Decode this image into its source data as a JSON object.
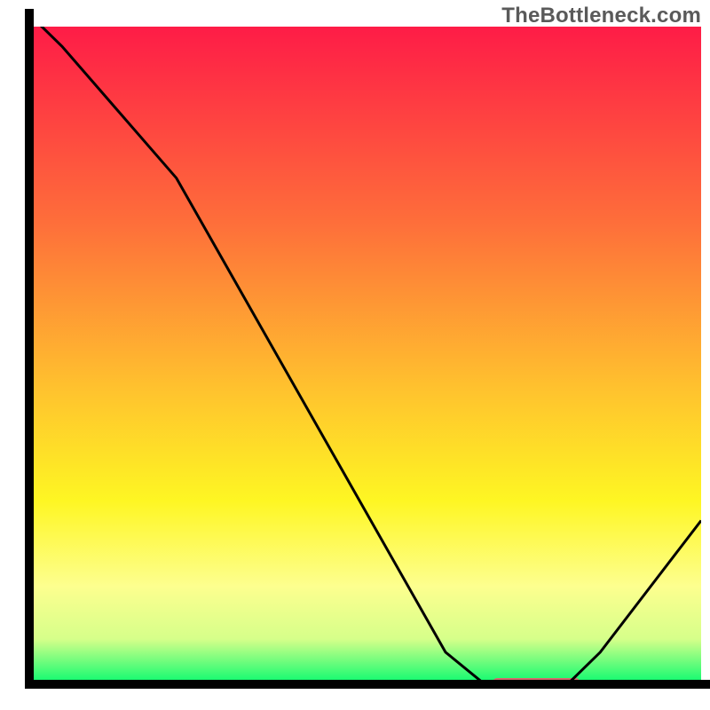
{
  "watermark": "TheBottleneck.com",
  "chart_data": {
    "type": "line",
    "title": "",
    "xlabel": "",
    "ylabel": "",
    "xlim": [
      0,
      100
    ],
    "ylim": [
      0,
      100
    ],
    "x": [
      0,
      5,
      22,
      62,
      68,
      80,
      85,
      100
    ],
    "values": [
      102,
      97,
      77,
      5,
      0,
      0,
      5,
      25
    ],
    "marker": {
      "x_start": 69,
      "x_end": 82,
      "y": 0
    },
    "gradient_stops": [
      {
        "offset": 0.0,
        "color": "#fe1c47"
      },
      {
        "offset": 0.3,
        "color": "#fe6f3a"
      },
      {
        "offset": 0.55,
        "color": "#ffc22e"
      },
      {
        "offset": 0.72,
        "color": "#fef623"
      },
      {
        "offset": 0.85,
        "color": "#fdff8f"
      },
      {
        "offset": 0.93,
        "color": "#d6ff8a"
      },
      {
        "offset": 1.0,
        "color": "#03fa6f"
      }
    ],
    "marker_color": "#d56a6d",
    "axis_color": "#000000",
    "line_color": "#000000"
  }
}
